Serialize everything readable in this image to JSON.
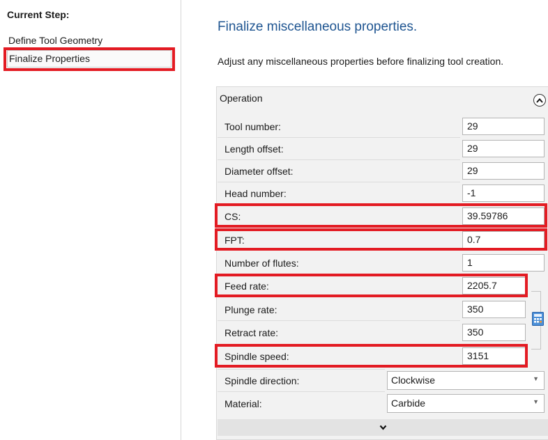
{
  "sidebar": {
    "heading": "Current Step:",
    "steps": [
      {
        "label": "Define Tool Geometry"
      },
      {
        "label": "Finalize Properties"
      }
    ]
  },
  "main": {
    "title": "Finalize miscellaneous properties.",
    "description": "Adjust any miscellaneous properties before finalizing tool creation."
  },
  "operation": {
    "header": "Operation",
    "fields": [
      {
        "label": "Tool number:",
        "value": "29"
      },
      {
        "label": "Length offset:",
        "value": "29"
      },
      {
        "label": "Diameter offset:",
        "value": "29"
      },
      {
        "label": "Head number:",
        "value": "-1"
      },
      {
        "label": "CS:",
        "value": "39.59786"
      },
      {
        "label": "FPT:",
        "value": "0.7"
      },
      {
        "label": "Number of flutes:",
        "value": "1"
      },
      {
        "label": "Feed rate:",
        "value": "2205.7"
      },
      {
        "label": "Plunge rate:",
        "value": "350"
      },
      {
        "label": "Retract rate:",
        "value": "350"
      },
      {
        "label": "Spindle speed:",
        "value": "3151"
      }
    ],
    "dropdowns": [
      {
        "label": "Spindle direction:",
        "value": "Clockwise"
      },
      {
        "label": "Material:",
        "value": "Carbide"
      }
    ]
  },
  "colors": {
    "title": "#1f5591",
    "highlight": "#e31b23",
    "panel_bg": "#f2f2f2"
  },
  "icons": {
    "collapse": "chevron-up-icon",
    "expand": "chevron-down-icon",
    "calculator": "calculator-icon",
    "dropdown": "caret-down-icon"
  }
}
